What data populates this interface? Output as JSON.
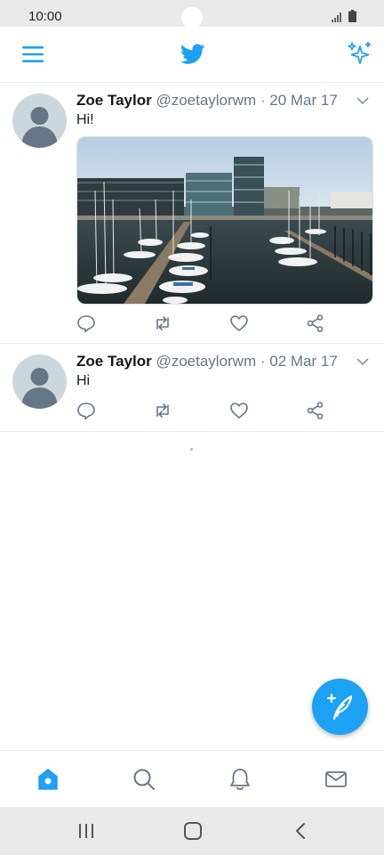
{
  "status_bar": {
    "time": "10:00"
  },
  "app_bar": {
    "menu_icon": "hamburger-menu-icon",
    "logo_icon": "twitter-bird-icon",
    "sparkle_icon": "sparkle-icon",
    "accent_color": "#1da1f2"
  },
  "tweets": [
    {
      "name": "Zoe Taylor",
      "handle": "@zoetaylorwm",
      "date": "· 20 Mar 17",
      "text": "Hi!",
      "has_media": true,
      "media_desc_icon": "photo-harbor"
    },
    {
      "name": "Zoe Taylor",
      "handle": "@zoetaylorwm",
      "date": "· 02 Mar 17",
      "text": "Hi",
      "has_media": false
    }
  ],
  "tweet_actions": [
    "reply-icon",
    "retweet-icon",
    "like-icon",
    "share-icon"
  ],
  "compose_button_icon": "compose-tweet-icon",
  "bottom_nav": [
    "home-icon",
    "search-icon",
    "notifications-icon",
    "messages-icon"
  ],
  "system_nav": [
    "recent-apps-icon",
    "home-button-icon",
    "back-icon"
  ]
}
